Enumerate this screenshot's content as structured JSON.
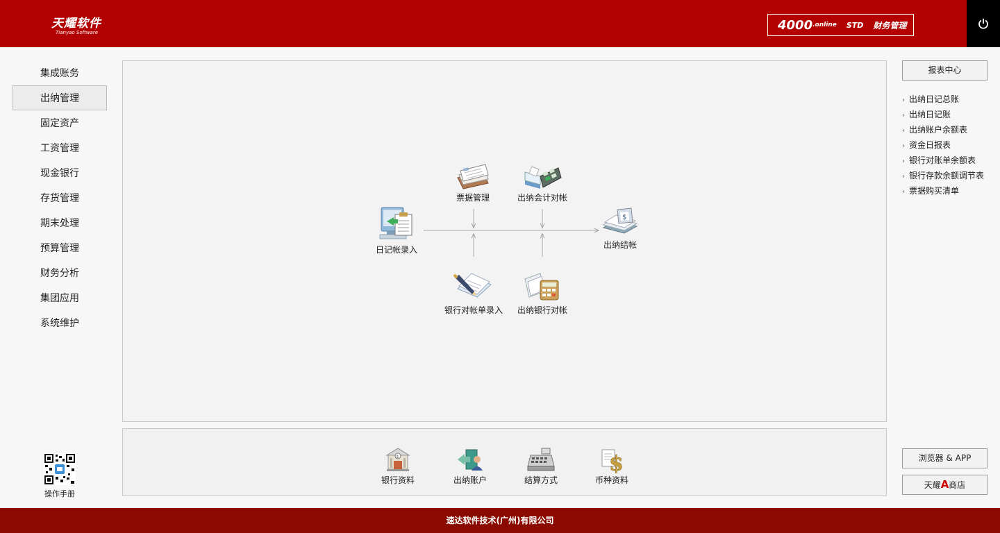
{
  "header": {
    "logo_cn": "天耀软件",
    "logo_en": "Tianyao Software",
    "product_num": "4000",
    "product_online": ".online",
    "product_std": "STD",
    "product_name": "财务管理"
  },
  "nav": {
    "items": [
      {
        "label": "集成账务"
      },
      {
        "label": "出纳管理",
        "active": true
      },
      {
        "label": "固定资产"
      },
      {
        "label": "工资管理"
      },
      {
        "label": "现金银行"
      },
      {
        "label": "存货管理"
      },
      {
        "label": "期末处理"
      },
      {
        "label": "预算管理"
      },
      {
        "label": "财务分析"
      },
      {
        "label": "集团应用"
      },
      {
        "label": "系统维护"
      }
    ],
    "qr_label": "操作手册"
  },
  "flow": {
    "journal_entry": "日记帐录入",
    "bill_mgmt": "票据管理",
    "cashier_acct_reconcile": "出纳会计对帐",
    "cashier_close": "出纳结帐",
    "bank_stmt_entry": "银行对帐单录入",
    "cashier_bank_reconcile": "出纳银行对帐"
  },
  "bottom": {
    "bank_info": "银行资料",
    "cashier_account": "出纳账户",
    "settlement_method": "结算方式",
    "currency_info": "币种资料"
  },
  "right": {
    "report_center": "报表中心",
    "reports": [
      "出纳日记总账",
      "出纳日记账",
      "出纳账户余额表",
      "资金日报表",
      "银行对账单余额表",
      "银行存款余额调节表",
      "票据购买清单"
    ],
    "browser_app": "浏览器 & APP",
    "store_prefix": "天耀",
    "store_mark": "A",
    "store_suffix": "商店"
  },
  "footer": {
    "company": "速达软件技术(广州)有限公司"
  },
  "colors": {
    "header_red": "#b30000",
    "footer_red": "#8b0a00",
    "power_bg": "#000000"
  }
}
